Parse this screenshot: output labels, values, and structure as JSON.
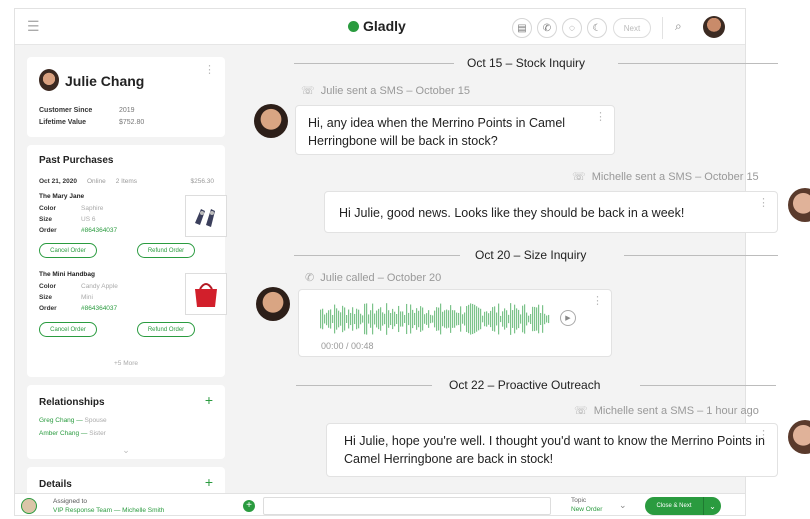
{
  "topbar": {
    "brand": "Gladly",
    "next_label": "Next"
  },
  "customer": {
    "name": "Julie Chang",
    "since_label": "Customer Since",
    "since_value": "2019",
    "ltv_label": "Lifetime Value",
    "ltv_value": "$752.80"
  },
  "purchases": {
    "title": "Past Purchases",
    "order_date": "Oct 21, 2020",
    "channel": "Online",
    "count": "2 Items",
    "amount": "$256.30",
    "items": [
      {
        "name": "The Mary Jane",
        "color_label": "Color",
        "color": "Saphire",
        "size_label": "Size",
        "size": "US 6",
        "order_label": "Order",
        "order": "#864364037",
        "cancel": "Cancel Order",
        "refund": "Refund Order"
      },
      {
        "name": "The Mini Handbag",
        "color_label": "Color",
        "color": "Candy Apple",
        "size_label": "Size",
        "size": "Mini",
        "order_label": "Order",
        "order": "#864364037",
        "cancel": "Cancel Order",
        "refund": "Refund Order"
      }
    ],
    "more": "+5 More"
  },
  "relationships": {
    "title": "Relationships",
    "items": [
      {
        "name": "Greg Chang",
        "role": "Spouse"
      },
      {
        "name": "Amber Chang",
        "role": "Sister"
      }
    ]
  },
  "details": {
    "title": "Details"
  },
  "bottombar": {
    "assigned_label": "Assigned to",
    "assigned_value": "VIP Response Team — Michelle Smith",
    "topic_label": "Topic",
    "topic_value": "New Order",
    "close_label": "Close & Next"
  },
  "timeline": {
    "sections": [
      {
        "date": "Oct 15 – Stock Inquiry"
      },
      {
        "date": "Oct 20 – Size Inquiry"
      },
      {
        "date": "Oct 22 – Proactive Outreach"
      }
    ],
    "events": [
      {
        "meta": "Julie sent a SMS – October 15",
        "text": "Hi, any idea when the Merrino Points in Camel Herringbone will be back in stock?"
      },
      {
        "meta": "Michelle sent a SMS – October 15",
        "text": "Hi Julie, good news. Looks like they should be back in a week!"
      },
      {
        "meta": "Julie called – October 20",
        "duration": "00:00 / 00:48"
      },
      {
        "meta": "Michelle sent a SMS – 1 hour ago",
        "text": "Hi Julie, hope you're well. I thought you'd want to know the Merrino Points in Camel Herringbone are back in stock!"
      }
    ]
  }
}
